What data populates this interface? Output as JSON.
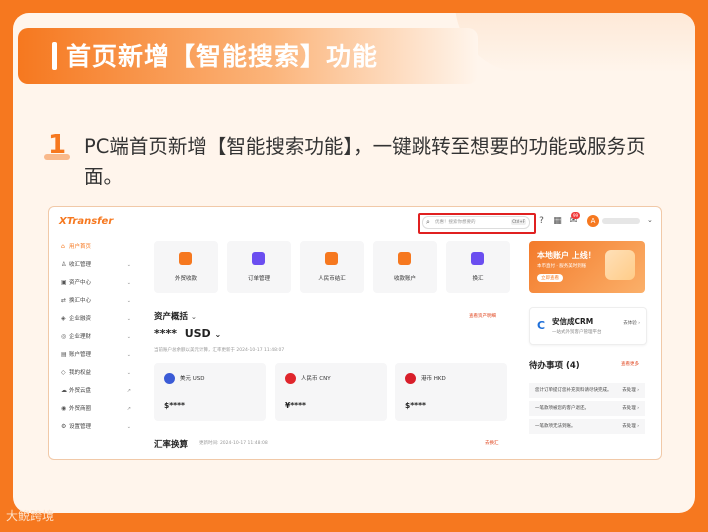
{
  "slide": {
    "title": "首页新增【智能搜索】功能",
    "step_number": "1",
    "step_text": "PC端首页新增【智能搜索功能】，一键跳转至想要的功能或服务页面。",
    "watermark": "大鲵跨境"
  },
  "app": {
    "logo": "XTransfer",
    "search": {
      "placeholder": "优惠！搜索你想要的",
      "shortcut": "Ctrl+F"
    },
    "notification_badge": "99",
    "avatar_letter": "A"
  },
  "sidebar": {
    "items": [
      {
        "label": "用户首页",
        "icon": "⌂",
        "active": true,
        "chevron": ""
      },
      {
        "label": "收汇管理",
        "icon": "♙",
        "chevron": "⌄"
      },
      {
        "label": "资产中心",
        "icon": "▣",
        "chevron": "⌄"
      },
      {
        "label": "换汇中心",
        "icon": "⇄",
        "chevron": "⌄"
      },
      {
        "label": "企业融资",
        "icon": "◈",
        "chevron": "⌄"
      },
      {
        "label": "企业理财",
        "icon": "◎",
        "chevron": "⌄"
      },
      {
        "label": "账户管理",
        "icon": "▤",
        "chevron": "⌄"
      },
      {
        "label": "我的权益",
        "icon": "◇",
        "chevron": "⌄"
      },
      {
        "label": "外贸云盘",
        "icon": "☁",
        "chevron": "↗"
      },
      {
        "label": "外贸商圈",
        "icon": "◉",
        "chevron": "↗"
      },
      {
        "label": "设置管理",
        "icon": "⚙",
        "chevron": "⌄"
      }
    ]
  },
  "quick_actions": [
    {
      "label": "外贸收款",
      "color": "#f6781f"
    },
    {
      "label": "订单管理",
      "color": "#6b4ef0"
    },
    {
      "label": "人民币结汇",
      "color": "#f6781f"
    },
    {
      "label": "收款账户",
      "color": "#f6781f"
    },
    {
      "label": "换汇",
      "color": "#6b4ef0"
    }
  ],
  "assets": {
    "title": "资产概括",
    "balance": "****",
    "currency": "USD",
    "note": "当前账户总余额以美元计算，汇率更新于 2024-10-17 11:48:07",
    "link": "查看资产明细",
    "accounts": [
      {
        "name": "美元 USD",
        "value": "$****",
        "flag_color": "#3b5bd6"
      },
      {
        "name": "人民币 CNY",
        "value": "¥****",
        "flag_color": "#e0262c"
      },
      {
        "name": "港币 HKD",
        "value": "$****",
        "flag_color": "#d81e2a"
      }
    ]
  },
  "exchange": {
    "title": "汇率换算",
    "meta": "更新时间: 2024-10-17 11:48:08",
    "link": "去换汇"
  },
  "promo": {
    "headline": "本地账户 上线！",
    "sub": "本币直付 · 服务美时到账",
    "cta": "立即查看"
  },
  "crm": {
    "logo": "C",
    "title": "安信成CRM",
    "subtitle": "一站式外贸客户管理平台",
    "go": "去体验 ›"
  },
  "todo": {
    "title": "待办事项 (4)",
    "link": "查看更多",
    "items": [
      {
        "text": "您计订单提订您补充资料请尽快完成。",
        "action": "去处理 ›"
      },
      {
        "text": "一笔款项被您的客户退还。",
        "action": "去处理 ›"
      },
      {
        "text": "一笔款项无法到账。",
        "action": "去处理 ›"
      }
    ]
  }
}
